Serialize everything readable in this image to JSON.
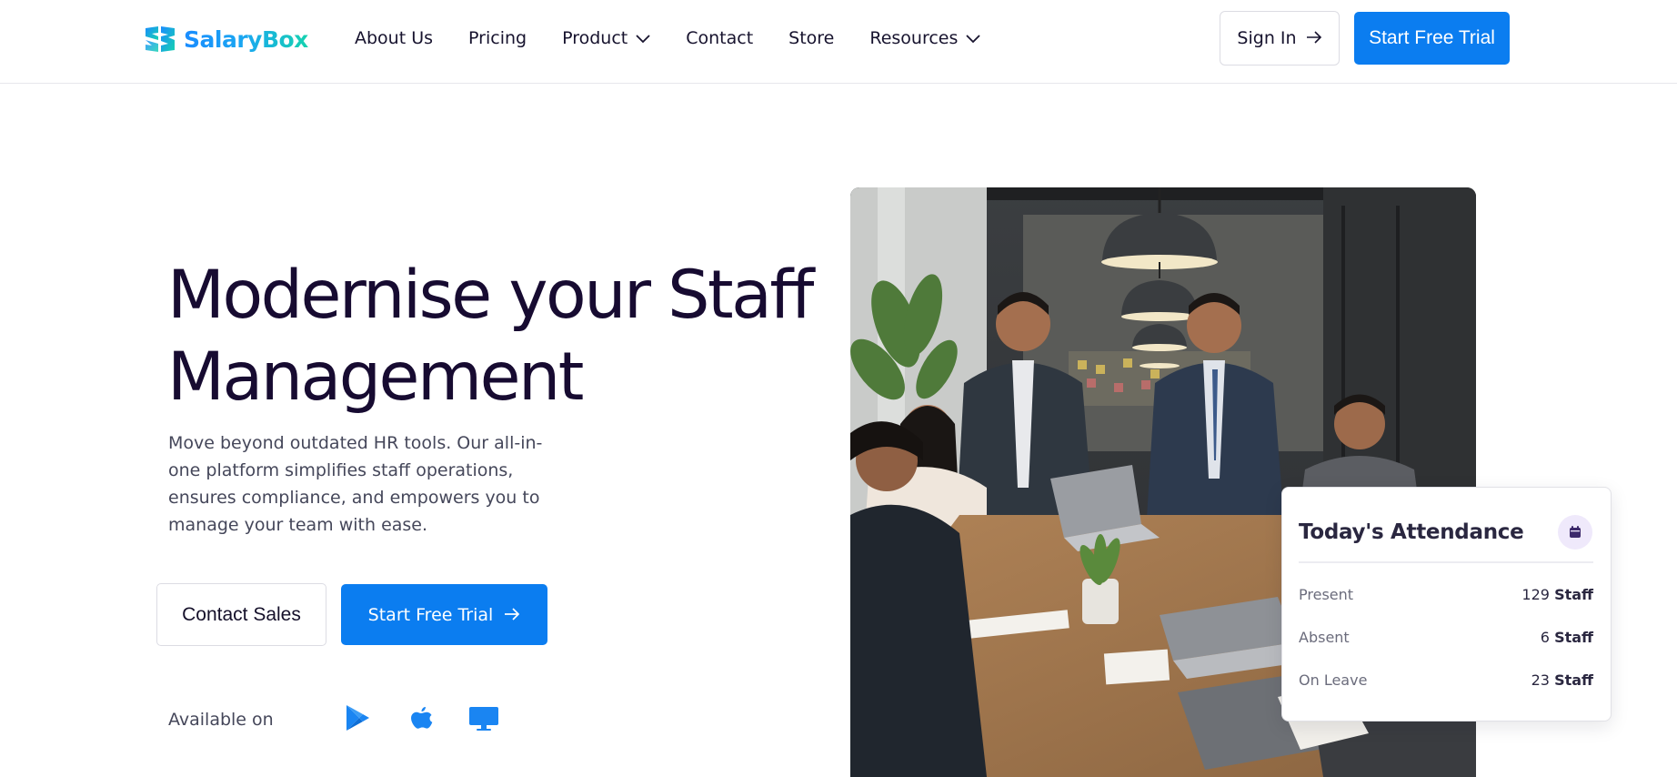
{
  "brand": {
    "name": "SalaryBox",
    "logo_icon": "salarybox-logo-icon"
  },
  "nav": {
    "links": [
      {
        "label": "About Us",
        "has_dropdown": false
      },
      {
        "label": "Pricing",
        "has_dropdown": false
      },
      {
        "label": "Product",
        "has_dropdown": true
      },
      {
        "label": "Contact",
        "has_dropdown": false
      },
      {
        "label": "Store",
        "has_dropdown": false
      },
      {
        "label": "Resources",
        "has_dropdown": true
      }
    ],
    "signin_label": "Sign In",
    "trial_label": "Start Free Trial"
  },
  "hero": {
    "title": "Modernise your Staff Management",
    "description": "Move beyond outdated HR tools. Our all-in-one platform simplifies staff operations, ensures compliance, and empowers you to manage your team with ease.",
    "contact_label": "Contact Sales",
    "trial_label": "Start Free Trial",
    "available_label": "Available on",
    "platform_icons": [
      "google-play-icon",
      "apple-icon",
      "desktop-icon"
    ]
  },
  "attendance": {
    "title": "Today's Attendance",
    "icon": "calendar-icon",
    "rows": [
      {
        "label": "Present",
        "count": "129",
        "unit": "Staff"
      },
      {
        "label": "Absent",
        "count": "6",
        "unit": "Staff"
      },
      {
        "label": "On Leave",
        "count": "23",
        "unit": "Staff"
      }
    ]
  },
  "colors": {
    "primary": "#0b7df0",
    "heading": "#170b31",
    "body_text": "#45475a",
    "logo_gradient_start": "#1a8cff",
    "logo_gradient_end": "#16d2b0"
  }
}
